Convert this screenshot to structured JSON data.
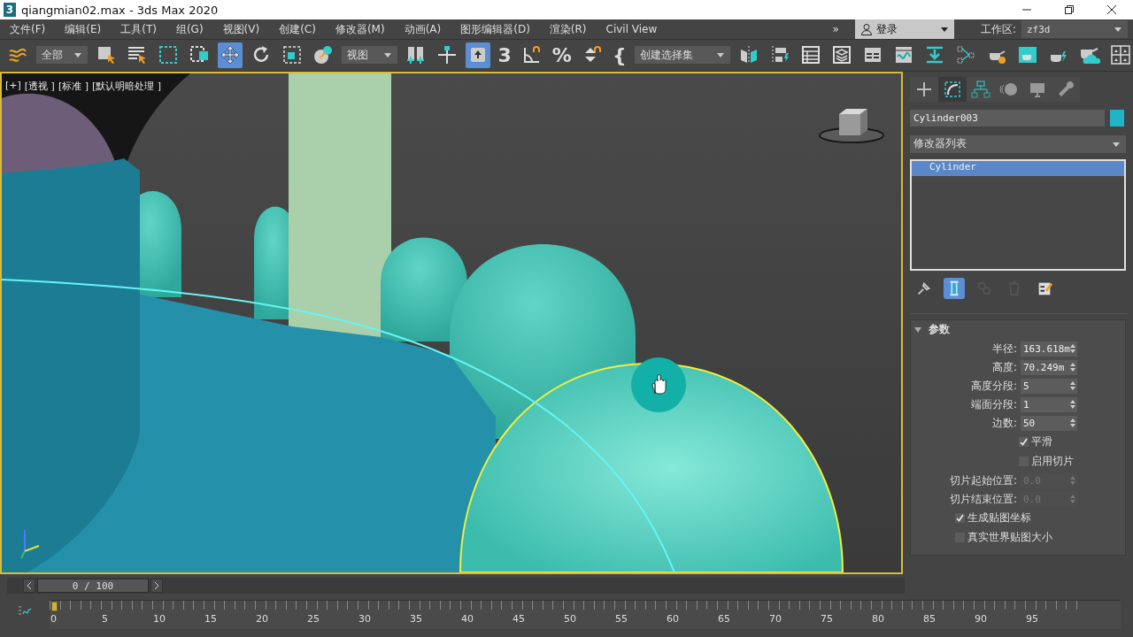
{
  "window": {
    "app_badge": "3",
    "title": "qiangmian02.max - 3ds Max 2020"
  },
  "menu": [
    {
      "label": "文件(F)"
    },
    {
      "label": "编辑(E)"
    },
    {
      "label": "工具(T)"
    },
    {
      "label": "组(G)"
    },
    {
      "label": "视图(V)"
    },
    {
      "label": "创建(C)"
    },
    {
      "label": "修改器(M)"
    },
    {
      "label": "动画(A)"
    },
    {
      "label": "图形编辑器(D)"
    },
    {
      "label": "渲染(R)"
    },
    {
      "label": "Civil View"
    }
  ],
  "menu_overflow": "»",
  "account": {
    "label": "登录"
  },
  "workspace": {
    "label": "工作区:",
    "value": "zf3d"
  },
  "toolbar": [
    {
      "kind": "tool",
      "selected": false
    },
    {
      "kind": "dropdown",
      "value": "全部"
    },
    {
      "kind": "tool",
      "selected": false
    },
    {
      "kind": "tool",
      "selected": false
    },
    {
      "kind": "tool",
      "selected": false
    },
    {
      "kind": "tool",
      "selected": false
    },
    {
      "kind": "tool",
      "selected": true
    },
    {
      "kind": "tool",
      "selected": false
    },
    {
      "kind": "tool",
      "selected": false
    },
    {
      "kind": "tool",
      "selected": false
    },
    {
      "kind": "dropdown",
      "value": "视图"
    },
    {
      "kind": "tool",
      "selected": false
    },
    {
      "kind": "tool",
      "selected": false
    },
    {
      "kind": "tool",
      "selected": true
    },
    {
      "kind": "glyph",
      "label": "3",
      "selected": false
    },
    {
      "kind": "tool",
      "selected": false
    },
    {
      "kind": "glyph",
      "label": "%",
      "selected": false
    },
    {
      "kind": "tool",
      "selected": false
    },
    {
      "kind": "glyph",
      "label": "{",
      "selected": false
    },
    {
      "kind": "dropdown",
      "value": "创建选择集"
    },
    {
      "kind": "tool",
      "selected": false
    },
    {
      "kind": "tool",
      "selected": false
    },
    {
      "kind": "tool",
      "selected": false
    },
    {
      "kind": "tool",
      "selected": false
    },
    {
      "kind": "tool",
      "selected": false
    },
    {
      "kind": "tool",
      "selected": false
    },
    {
      "kind": "tool",
      "selected": false
    },
    {
      "kind": "tool",
      "selected": false
    },
    {
      "kind": "tool",
      "selected": false
    },
    {
      "kind": "tool",
      "selected": false
    },
    {
      "kind": "tool",
      "selected": false
    },
    {
      "kind": "tool",
      "selected": false
    },
    {
      "kind": "tool",
      "selected": false
    }
  ],
  "viewport": {
    "active": true,
    "labels": [
      "[+]",
      "[透视 ]",
      "[标准 ]",
      "[默认明暗处理 ]"
    ]
  },
  "command_panel": {
    "tabs": [
      {
        "selected": false
      },
      {
        "selected": true
      },
      {
        "selected": false
      },
      {
        "selected": false
      },
      {
        "selected": false
      },
      {
        "selected": false
      }
    ],
    "object_name": "Cylinder003",
    "modifier_list": "修改器列表",
    "stack": [
      {
        "label": "Cylinder",
        "selected": true
      }
    ],
    "stack_tools": [
      {
        "selected": false,
        "disabled": false
      },
      {
        "selected": true,
        "disabled": false
      },
      {
        "selected": false,
        "disabled": true
      },
      {
        "selected": false,
        "disabled": true
      },
      {
        "selected": false,
        "disabled": false
      }
    ],
    "rollout": {
      "title": "参数",
      "expanded": true,
      "controls": [
        {
          "kind": "spinner",
          "label": "半径:",
          "value": "163.618m",
          "disabled": false
        },
        {
          "kind": "spinner",
          "label": "高度:",
          "value": "70.249m",
          "disabled": false
        },
        {
          "kind": "spinner",
          "label": "高度分段:",
          "value": "5",
          "disabled": false
        },
        {
          "kind": "spinner",
          "label": "端面分段:",
          "value": "1",
          "disabled": false
        },
        {
          "kind": "spinner",
          "label": "边数:",
          "value": "50",
          "disabled": false
        },
        {
          "kind": "toggle",
          "label": "平滑",
          "checked": true
        },
        {
          "kind": "toggle",
          "label": "启用切片",
          "checked": false
        },
        {
          "kind": "spinner",
          "label": "切片起始位置:",
          "value": "0.0",
          "disabled": true
        },
        {
          "kind": "spinner",
          "label": "切片结束位置:",
          "value": "0.0",
          "disabled": true
        },
        {
          "kind": "checkbox",
          "label": "生成贴图坐标",
          "checked": true
        },
        {
          "kind": "checkbox",
          "label": "真实世界贴图大小",
          "checked": false
        }
      ]
    }
  },
  "timeline": {
    "frame": "0 / 100",
    "level": 0,
    "ticks": [
      "0",
      "5",
      "10",
      "15",
      "20",
      "25",
      "30",
      "35",
      "40",
      "45",
      "50",
      "55",
      "60",
      "65",
      "70",
      "75",
      "80",
      "85",
      "90",
      "95"
    ]
  }
}
